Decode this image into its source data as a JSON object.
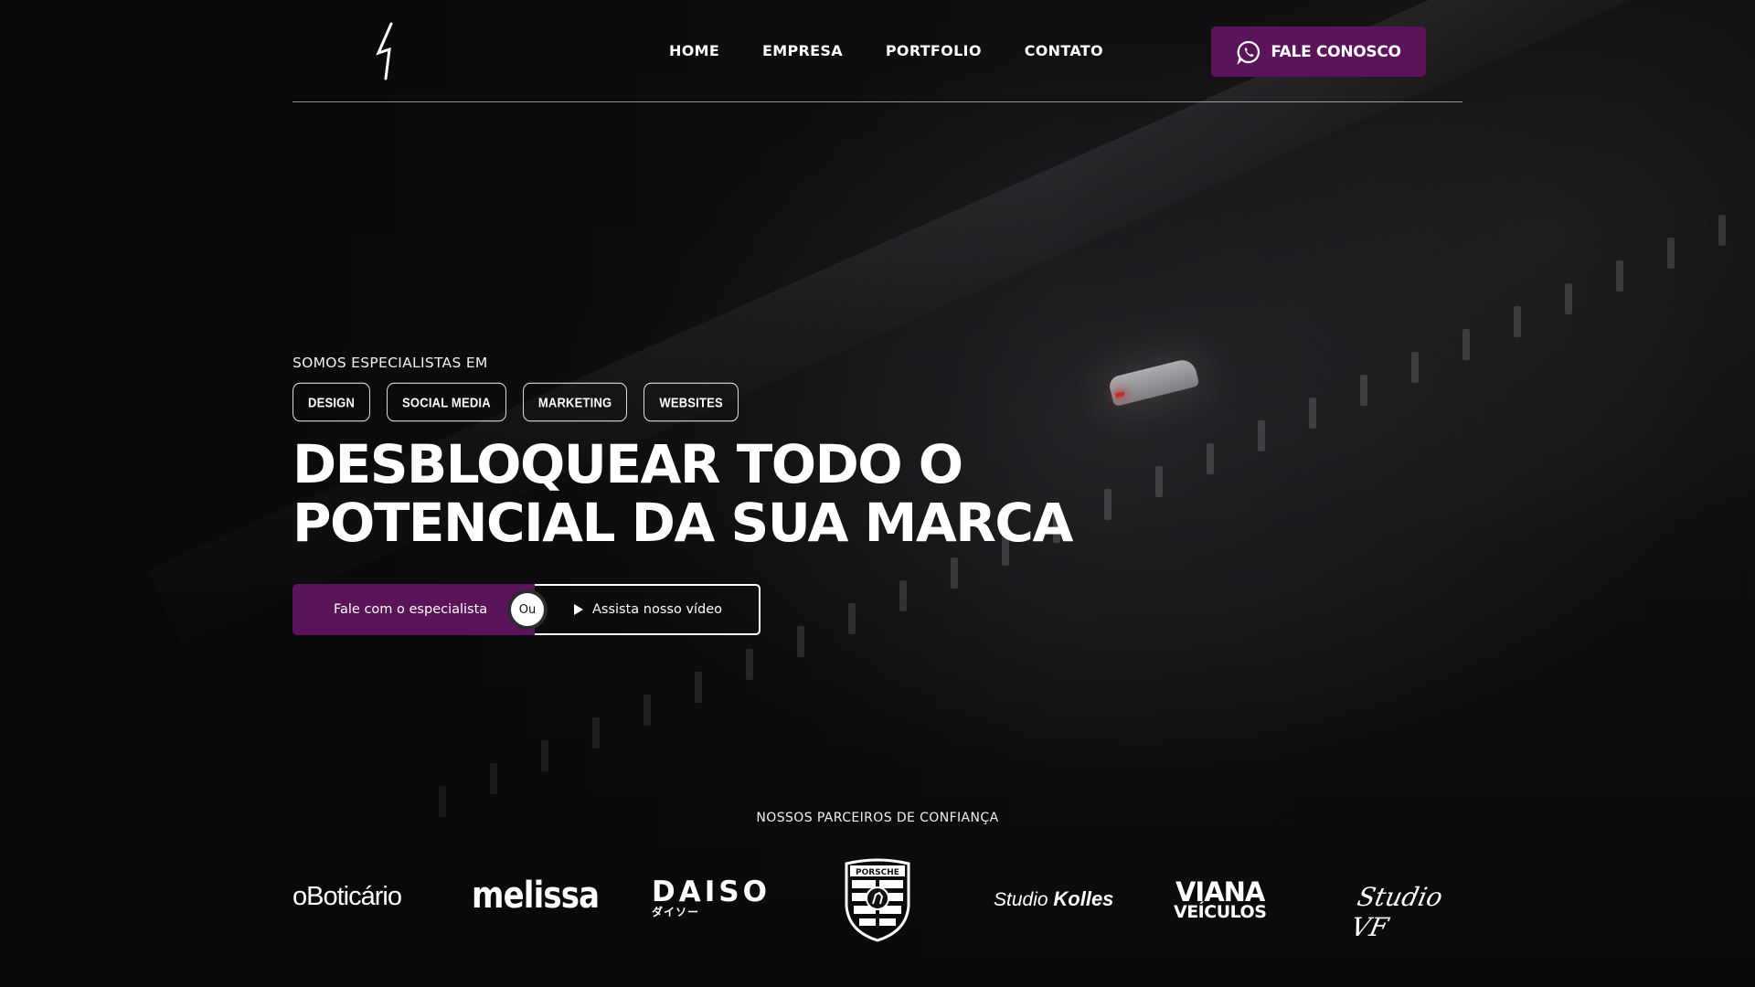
{
  "nav": {
    "logo": "lightning-logo",
    "items": [
      {
        "label": "HOME"
      },
      {
        "label": "EMPRESA"
      },
      {
        "label": "PORTFOLIO"
      },
      {
        "label": "CONTATO"
      }
    ],
    "cta_label": "FALE CONOSCO",
    "cta_icon": "whatsapp-icon"
  },
  "hero": {
    "eyebrow": "SOMOS ESPECIALISTAS EM",
    "tags": [
      "DESIGN",
      "SOCIAL MEDIA",
      "MARKETING",
      "WEBSITES"
    ],
    "headline_line1": "DESBLOQUEAR TODO O",
    "headline_line2": "POTENCIAL DA SUA MARCA",
    "primary_button": "Fale com o especialista",
    "or_label": "Ou",
    "secondary_button": "Assista nosso vídeo",
    "secondary_icon": "play-icon"
  },
  "partners": {
    "title": "NOSSOS PARCEIROS DE CONFIANÇA",
    "boticario": "oBoticário",
    "melissa": "melissa",
    "daiso": "DAISO",
    "daiso_sub": "ダイソー",
    "porsche": "PORSCHE",
    "kolles_light": "Studio",
    "kolles_bold": "Kolles",
    "viana_l1": "VIANA",
    "viana_l2": "VEÍCULOS",
    "studiovf": "Studio VF"
  },
  "colors": {
    "accent": "#5b1459",
    "background": "#0c0b0d",
    "text": "#ffffff"
  }
}
